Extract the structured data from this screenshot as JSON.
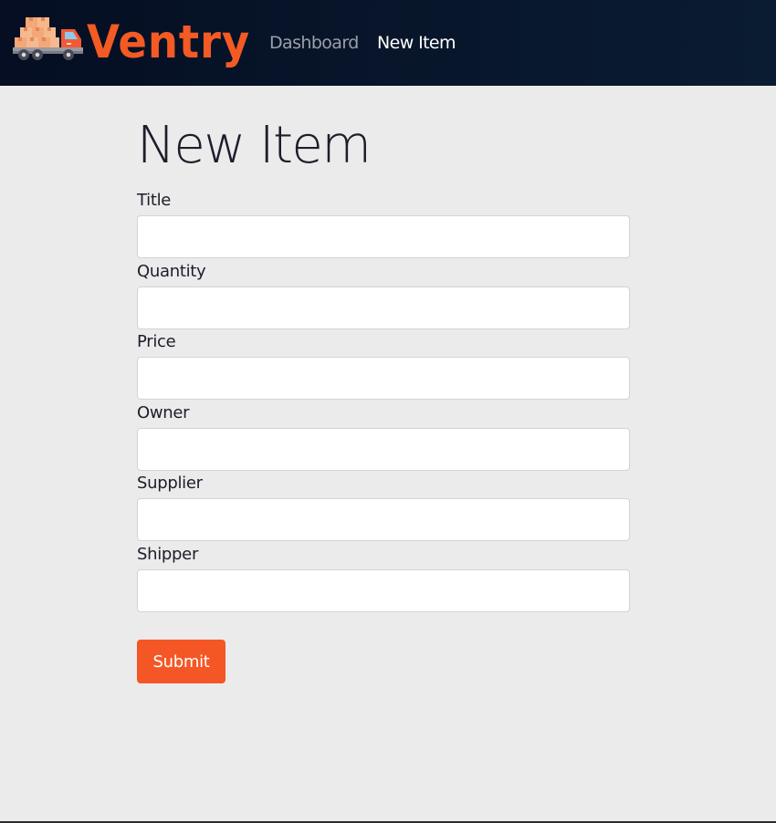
{
  "brand": {
    "name": "Ventry",
    "logo_icon": "delivery-truck-with-boxes-icon"
  },
  "nav": {
    "items": [
      {
        "label": "Dashboard",
        "active": false
      },
      {
        "label": "New Item",
        "active": true
      }
    ]
  },
  "page": {
    "title": "New Item"
  },
  "form": {
    "fields": [
      {
        "label": "Title",
        "value": "",
        "placeholder": ""
      },
      {
        "label": "Quantity",
        "value": "",
        "placeholder": ""
      },
      {
        "label": "Price",
        "value": "",
        "placeholder": ""
      },
      {
        "label": "Owner",
        "value": "",
        "placeholder": ""
      },
      {
        "label": "Supplier",
        "value": "",
        "placeholder": ""
      },
      {
        "label": "Shipper",
        "value": "",
        "placeholder": ""
      }
    ],
    "submit_label": "Submit"
  },
  "colors": {
    "navbar_bg": "#061125",
    "brand_accent": "#f35a24",
    "button_bg": "#f45725",
    "page_bg": "#ebebeb"
  }
}
